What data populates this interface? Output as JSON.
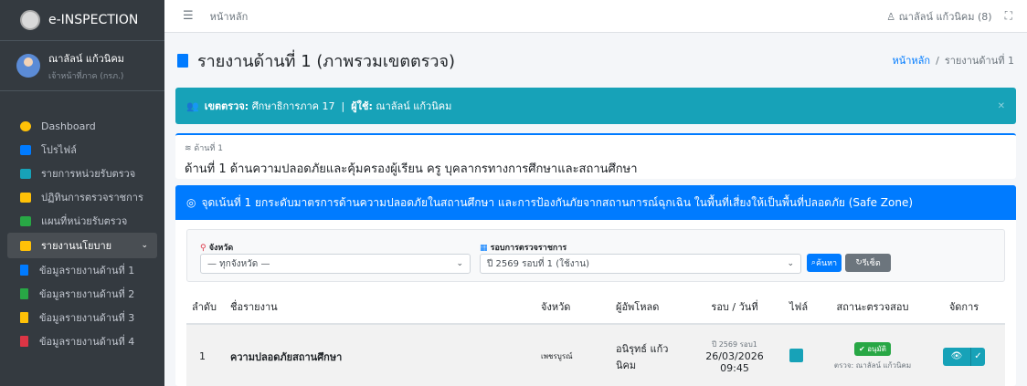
{
  "brand": {
    "title": "e-INSPECTION"
  },
  "user": {
    "name": "ณาลัลน์ แก้วนิคม",
    "role": "เจ้าหน้าที่ภาค (กรภ.)"
  },
  "sidebar": {
    "items": [
      {
        "label": "Dashboard",
        "color": "#ffc107"
      },
      {
        "label": "โปรไฟล์",
        "color": "#007bff"
      },
      {
        "label": "รายการหน่วยรับตรวจ",
        "color": "#17a2b8"
      },
      {
        "label": "ปฏิทินการตรวจราชการ",
        "color": "#ffc107"
      },
      {
        "label": "แผนที่หน่วยรับตรวจ",
        "color": "#28a745"
      },
      {
        "label": "รายงานนโยบาย",
        "color": "#ffc107"
      }
    ],
    "sub_items": [
      {
        "label": "ข้อมูลรายงานด้านที่ 1",
        "color": "#007bff"
      },
      {
        "label": "ข้อมูลรายงานด้านที่ 2",
        "color": "#28a745"
      },
      {
        "label": "ข้อมูลรายงานด้านที่ 3",
        "color": "#ffc107"
      },
      {
        "label": "ข้อมูลรายงานด้านที่ 4",
        "color": "#dc3545"
      }
    ]
  },
  "topbar": {
    "home": "หน้าหลัก",
    "user": "ณาลัลน์ แก้วนิคม (8)"
  },
  "page": {
    "title": "รายงานด้านที่ 1 (ภาพรวมเขตตรวจ)",
    "breadcrumb_home": "หน้าหลัก",
    "breadcrumb_current": "รายงานด้านที่ 1"
  },
  "alert": {
    "zone_label": "เขตตรวจ:",
    "zone_value": "ศึกษาธิการภาค 17",
    "user_label": "ผู้ใช้:",
    "user_value": "ณาลัลน์ แก้วนิคม"
  },
  "aspect": {
    "small": "ด้านที่ 1",
    "title": "ด้านที่ 1 ด้านความปลอดภัยและคุ้มครองผู้เรียน ครู บุคลากรทางการศึกษาและสถานศึกษา"
  },
  "focus": {
    "title": "จุดเน้นที่ 1 ยกระดับมาตรการด้านความปลอดภัยในสถานศึกษา และการป้องกันภัยจากสถานการณ์ฉุกเฉิน ในพื้นที่เสี่ยงให้เป็นพื้นที่ปลอดภัย (Safe Zone)"
  },
  "filters": {
    "province_label": "จังหวัด",
    "province_value": "— ทุกจังหวัด —",
    "round_label": "รอบการตรวจราชการ",
    "round_value": "ปี 2569 รอบที่ 1 (ใช้งาน)",
    "search_label": "ค้นหา",
    "reset_label": "รีเซ็ต"
  },
  "table": {
    "headers": [
      "ลำดับ",
      "ชื่อรายงาน",
      "จังหวัด",
      "ผู้อัพโหลด",
      "รอบ / วันที่",
      "ไฟล์",
      "สถานะตรวจสอบ",
      "จัดการ"
    ],
    "rows": [
      {
        "no": "1",
        "name": "ความปลอดภัยสถานศึกษา",
        "province": "เพชรบูรณ์",
        "uploader": "อนิรุทธ์ แก้วนิคม",
        "round": "ปี 2569 รอบ1",
        "date": "26/03/2026",
        "time": "09:45",
        "status": "อนุมัติ",
        "checker": "ตรวจ: ณาลัลน์ แก้วนิคม"
      }
    ]
  }
}
